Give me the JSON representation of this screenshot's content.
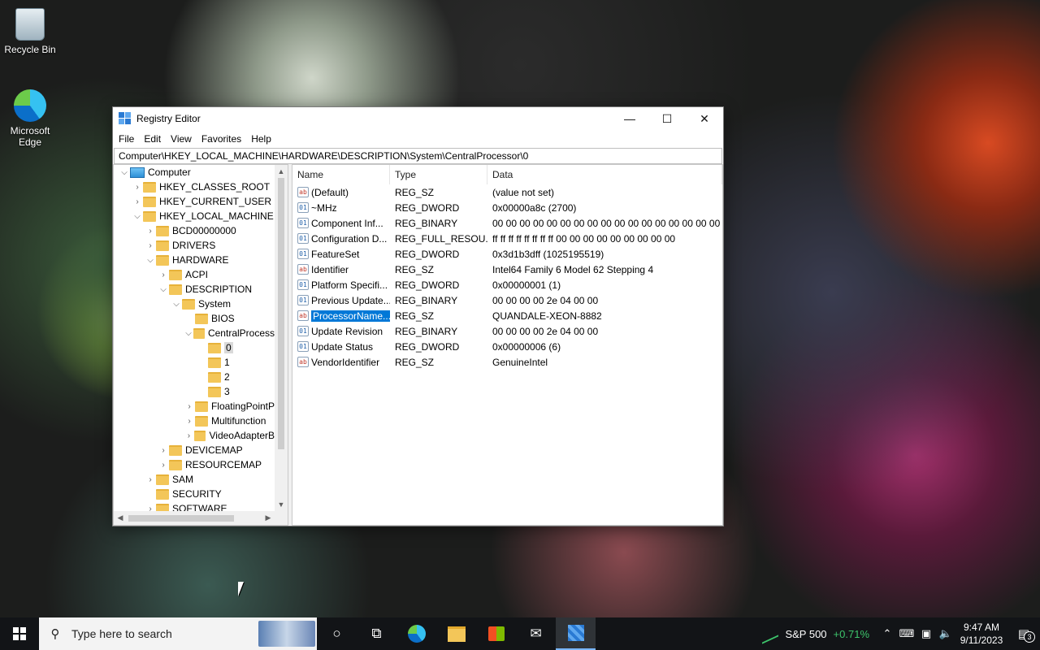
{
  "desktop": {
    "icons": [
      {
        "label": "Recycle Bin"
      },
      {
        "label": "Microsoft Edge"
      }
    ]
  },
  "window": {
    "title": "Registry Editor",
    "controls": {
      "minimize": "—",
      "maximize": "☐",
      "close": "✕"
    },
    "menu": [
      "File",
      "Edit",
      "View",
      "Favorites",
      "Help"
    ],
    "address": "Computer\\HKEY_LOCAL_MACHINE\\HARDWARE\\DESCRIPTION\\System\\CentralProcessor\\0"
  },
  "tree": [
    {
      "label": "Computer",
      "twisty": "⌵",
      "icon": "pc",
      "indent": 0
    },
    {
      "label": "HKEY_CLASSES_ROOT",
      "twisty": "›",
      "indent": 1
    },
    {
      "label": "HKEY_CURRENT_USER",
      "twisty": "›",
      "indent": 1
    },
    {
      "label": "HKEY_LOCAL_MACHINE",
      "twisty": "⌵",
      "indent": 1
    },
    {
      "label": "BCD00000000",
      "twisty": "›",
      "indent": 2
    },
    {
      "label": "DRIVERS",
      "twisty": "›",
      "indent": 2
    },
    {
      "label": "HARDWARE",
      "twisty": "⌵",
      "indent": 2
    },
    {
      "label": "ACPI",
      "twisty": "›",
      "indent": 3
    },
    {
      "label": "DESCRIPTION",
      "twisty": "⌵",
      "indent": 3
    },
    {
      "label": "System",
      "twisty": "⌵",
      "indent": 4
    },
    {
      "label": "BIOS",
      "twisty": "",
      "indent": 5
    },
    {
      "label": "CentralProcess",
      "twisty": "⌵",
      "indent": 5
    },
    {
      "label": "0",
      "twisty": "",
      "indent": 6,
      "selected": true
    },
    {
      "label": "1",
      "twisty": "",
      "indent": 6
    },
    {
      "label": "2",
      "twisty": "",
      "indent": 6
    },
    {
      "label": "3",
      "twisty": "",
      "indent": 6
    },
    {
      "label": "FloatingPointP",
      "twisty": "›",
      "indent": 5
    },
    {
      "label": "Multifunction",
      "twisty": "›",
      "indent": 5
    },
    {
      "label": "VideoAdapterB",
      "twisty": "›",
      "indent": 5
    },
    {
      "label": "DEVICEMAP",
      "twisty": "›",
      "indent": 3
    },
    {
      "label": "RESOURCEMAP",
      "twisty": "›",
      "indent": 3
    },
    {
      "label": "SAM",
      "twisty": "›",
      "indent": 2
    },
    {
      "label": "SECURITY",
      "twisty": "",
      "indent": 2
    },
    {
      "label": "SOFTWARE",
      "twisty": "›",
      "indent": 2
    }
  ],
  "list": {
    "columns": [
      "Name",
      "Type",
      "Data"
    ],
    "rows": [
      {
        "name": "(Default)",
        "type": "REG_SZ",
        "data": "(value not set)",
        "kind": "sz"
      },
      {
        "name": "~MHz",
        "type": "REG_DWORD",
        "data": "0x00000a8c (2700)",
        "kind": "bin"
      },
      {
        "name": "Component Inf...",
        "type": "REG_BINARY",
        "data": "00 00 00 00 00 00 00 00 00 00 00 00 00 00 00 00 00 00",
        "kind": "bin"
      },
      {
        "name": "Configuration D...",
        "type": "REG_FULL_RESOU...",
        "data": "ff ff ff ff ff ff ff ff 00 00 00 00 00 00 00 00 00",
        "kind": "bin"
      },
      {
        "name": "FeatureSet",
        "type": "REG_DWORD",
        "data": "0x3d1b3dff (1025195519)",
        "kind": "bin"
      },
      {
        "name": "Identifier",
        "type": "REG_SZ",
        "data": "Intel64 Family 6 Model 62 Stepping 4",
        "kind": "sz"
      },
      {
        "name": "Platform Specifi...",
        "type": "REG_DWORD",
        "data": "0x00000001 (1)",
        "kind": "bin"
      },
      {
        "name": "Previous Update...",
        "type": "REG_BINARY",
        "data": "00 00 00 00 2e 04 00 00",
        "kind": "bin"
      },
      {
        "name": "ProcessorName...",
        "type": "REG_SZ",
        "data": "QUANDALE-XEON-8882",
        "kind": "sz",
        "selected": true
      },
      {
        "name": "Update Revision",
        "type": "REG_BINARY",
        "data": "00 00 00 00 2e 04 00 00",
        "kind": "bin"
      },
      {
        "name": "Update Status",
        "type": "REG_DWORD",
        "data": "0x00000006 (6)",
        "kind": "bin"
      },
      {
        "name": "VendorIdentifier",
        "type": "REG_SZ",
        "data": "GenuineIntel",
        "kind": "sz"
      }
    ]
  },
  "taskbar": {
    "search_placeholder": "Type here to search",
    "stock_name": "S&P 500",
    "stock_change": "+0.71%",
    "time": "9:47 AM",
    "date": "9/11/2023",
    "notification_count": "3"
  }
}
